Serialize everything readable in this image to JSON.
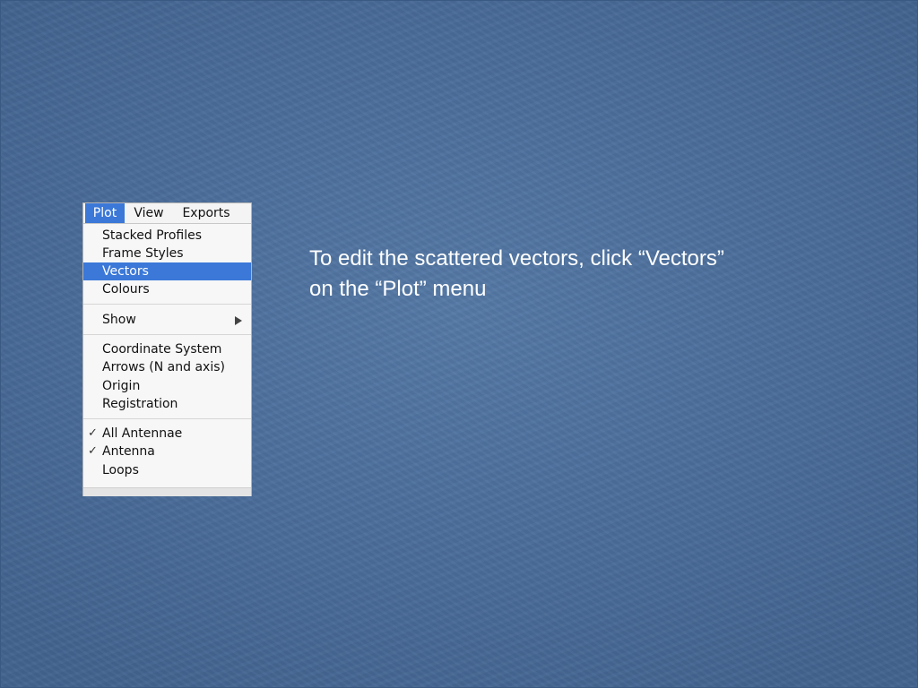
{
  "menubar": {
    "items": [
      {
        "label": "Plot",
        "active": true
      },
      {
        "label": "View",
        "active": false
      },
      {
        "label": "Exports",
        "active": false
      }
    ]
  },
  "menu": {
    "items": [
      {
        "label": "Stacked Profiles"
      },
      {
        "label": "Frame Styles"
      },
      {
        "label": "Vectors",
        "selected": true
      },
      {
        "label": "Colours"
      },
      {
        "label": "Show",
        "submenu": true
      },
      {
        "label": "Coordinate System"
      },
      {
        "label": "Arrows (N and axis)"
      },
      {
        "label": "Origin"
      },
      {
        "label": "Registration"
      },
      {
        "label": "All Antennae",
        "checked": true
      },
      {
        "label": "Antenna",
        "checked": true
      },
      {
        "label": "Loops"
      }
    ],
    "check_glyph": "✓",
    "highlight_color": "#3b78d8"
  },
  "caption": {
    "line1": "To edit the scattered vectors, click “Vectors”",
    "line2": "on the “Plot” menu"
  },
  "colors": {
    "background": "#4c6f9c",
    "caption_text": "#ffffff"
  }
}
